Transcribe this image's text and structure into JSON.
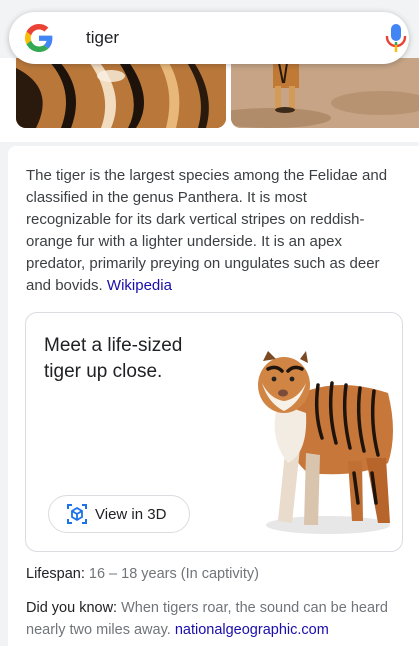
{
  "search": {
    "query": "tiger",
    "logo_icon": "google-g-icon",
    "mic_icon": "microphone-icon"
  },
  "images": {
    "thumbs": [
      "tiger-closeup-image",
      "tiger-walking-image"
    ]
  },
  "knowledge": {
    "description": "The tiger is the largest species among the Felidae and classified in the genus Panthera. It is most recognizable for its dark vertical stripes on reddish-orange fur with a lighter underside. It is an apex predator, primarily preying on ungulates such as deer and bovids.",
    "source_link": "Wikipedia",
    "ar": {
      "title": "Meet a life-sized tiger up close.",
      "button_label": "View in 3D",
      "button_icon": "3d-cube-icon"
    },
    "lifespan": {
      "label": "Lifespan:",
      "value": "16 – 18 years (In captivity)"
    },
    "did_you_know": {
      "label": "Did you know:",
      "value": "When tigers roar, the sound can be heard nearly two miles away.",
      "link": "nationalgeographic.com"
    }
  },
  "colors": {
    "link": "#1a0dab",
    "google_blue": "#4285F4",
    "google_red": "#EA4335",
    "google_yellow": "#FBBC05",
    "google_green": "#34A853"
  }
}
